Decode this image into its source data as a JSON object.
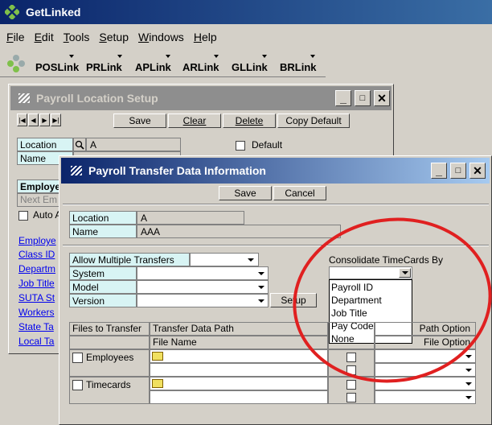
{
  "app": {
    "title": "GetLinked"
  },
  "menu": [
    "File",
    "Edit",
    "Tools",
    "Setup",
    "Windows",
    "Help"
  ],
  "toolbar": [
    "POSLink",
    "PRLink",
    "APLink",
    "ARLink",
    "GLLink",
    "BRLink"
  ],
  "location_setup": {
    "title": "Payroll Location Setup",
    "buttons": {
      "save": "Save",
      "clear": "Clear",
      "delete": "Delete",
      "copy_default": "Copy Default"
    },
    "location_label": "Location",
    "location_value": "A",
    "name_label": "Name",
    "default_label": "Default",
    "employee_label": "Employe",
    "next_emp_label": "Next Em",
    "auto_label": "Auto A",
    "employee_section": "Employe",
    "links": [
      "Class ID",
      "Departm",
      "Job Title",
      "SUTA St",
      "Workers",
      "State Ta",
      "Local Ta"
    ]
  },
  "transfer": {
    "title": "Payroll Transfer Data Information",
    "buttons": {
      "save": "Save",
      "cancel": "Cancel"
    },
    "location_label": "Location",
    "location_value": "A",
    "name_label": "Name",
    "name_value": "AAA",
    "allow_multiple_label": "Allow Multiple Transfers",
    "system_label": "System",
    "model_label": "Model",
    "version_label": "Version",
    "setup_label": "Setup",
    "consolidate_label": "Consolidate TimeCards By",
    "consolidate_options": [
      "Payroll ID",
      "Department",
      "Job Title",
      "Pay Code",
      "None"
    ],
    "table": {
      "col1": "Files to Transfer",
      "col2": "Transfer Data Path",
      "col2_sub": "File Name",
      "col4": "Path Option",
      "col4_sub": "File Option",
      "rows": [
        "Employees",
        "Timecards"
      ]
    }
  },
  "colors": {
    "title_active": "#0a246a",
    "title_inactive": "#808080",
    "annotation": "#e02020",
    "label_bg": "#d8f4f4"
  }
}
